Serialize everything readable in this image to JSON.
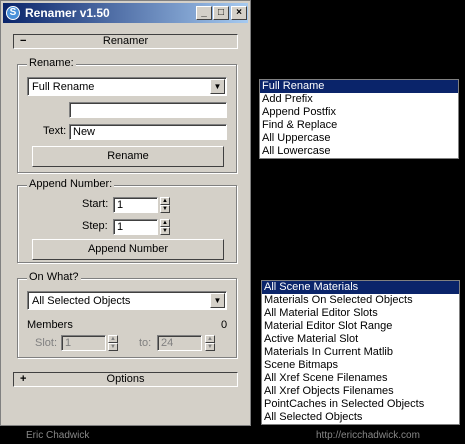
{
  "window": {
    "title": "Renamer v1.50",
    "min": "_",
    "max": "□",
    "close": "×",
    "app_icon": "S"
  },
  "rollout_main": {
    "sign": "−",
    "label": "Renamer"
  },
  "rename_group": {
    "legend": "Rename:",
    "mode_value": "Full Rename",
    "field_value": "",
    "text_label": "Text:",
    "text_value": "New",
    "button": "Rename"
  },
  "append_group": {
    "legend": "Append Number:",
    "start_label": "Start:",
    "start_value": "1",
    "step_label": "Step:",
    "step_value": "1",
    "button": "Append Number"
  },
  "onwhat_group": {
    "legend": "On What?",
    "selection_value": "All Selected Objects",
    "members_label": "Members",
    "members_count": "0",
    "slot_label": "Slot:",
    "slot_value": "1",
    "to_label": "to:",
    "to_value": "24"
  },
  "rollout_options": {
    "sign": "+",
    "label": "Options"
  },
  "rename_mode_list": [
    "Full Rename",
    "Add Prefix",
    "Append Postfix",
    "Find & Replace",
    "All Uppercase",
    "All Lowercase"
  ],
  "rename_mode_selected": 0,
  "on_what_list": [
    "All Scene Materials",
    "Materials On Selected Objects",
    "All Material Editor Slots",
    "Material Editor Slot Range",
    "Active Material Slot",
    "Materials In Current Matlib",
    "Scene Bitmaps",
    "All Xref Scene Filenames",
    "All Xref Objects Filenames",
    "PointCaches in Selected Objects",
    "All Selected Objects"
  ],
  "on_what_selected": 0,
  "footer": {
    "author": "Eric Chadwick",
    "url": "http://ericchadwick.com"
  }
}
